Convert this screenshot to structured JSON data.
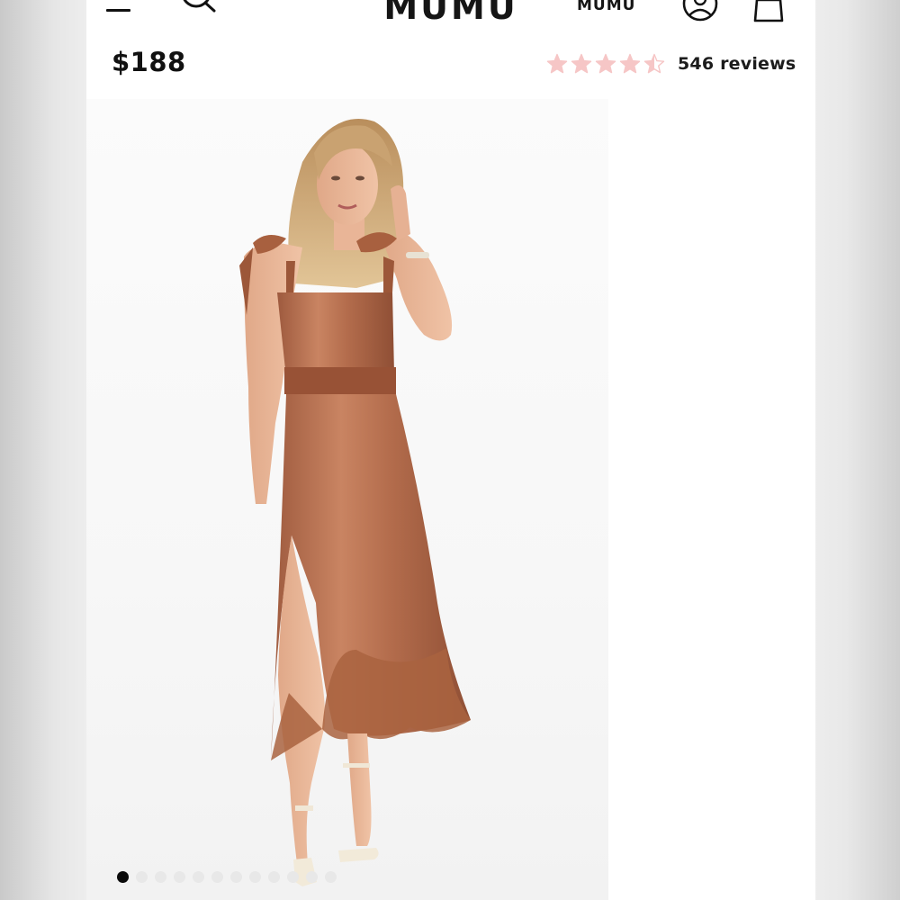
{
  "header": {
    "logo": "MUMU",
    "logo_secondary": "MUMU",
    "icons": [
      "menu-icon",
      "search-icon",
      "account-icon",
      "shopping-bag-icon"
    ]
  },
  "product": {
    "price": "$188",
    "rating": 4.5,
    "reviews_label": "546 reviews",
    "star_color": "#f6c6c6"
  },
  "gallery": {
    "slide_count": 12,
    "active_slide": 1,
    "dress_color": "#b8704f"
  }
}
